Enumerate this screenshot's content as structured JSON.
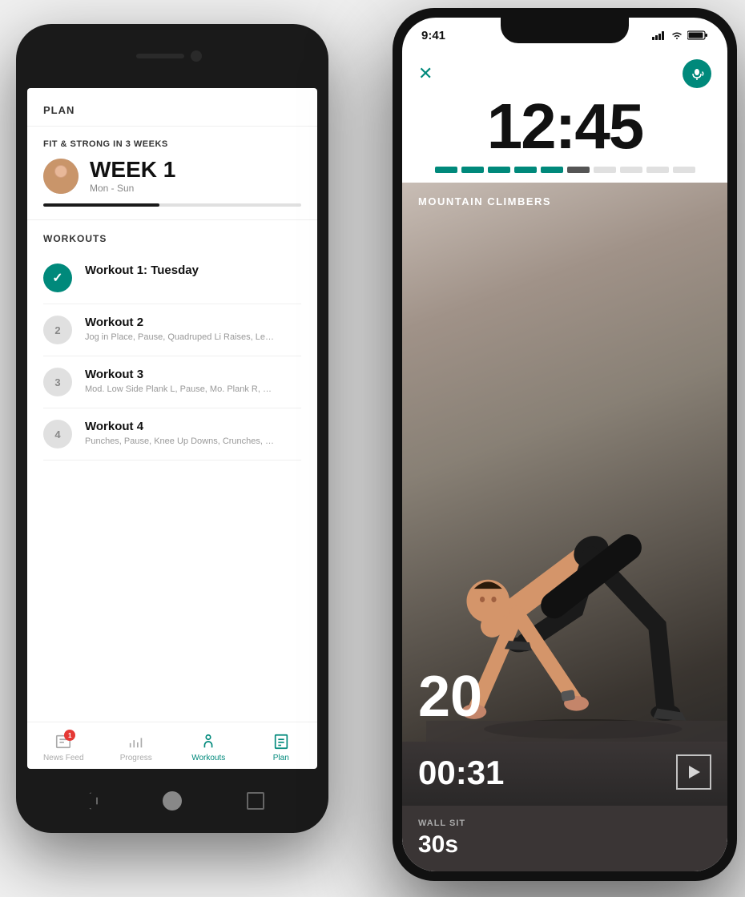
{
  "left_phone": {
    "plan_header": "PLAN",
    "plan_name": "FIT & STRONG IN 3 WEEKS",
    "week_label": "WEEK 1",
    "week_days": "Mon - Sun",
    "progress_percent": 45,
    "workouts_header": "WORKOUTS",
    "workouts": [
      {
        "id": 1,
        "name": "Workout 1: Tuesday",
        "desc": "",
        "completed": true
      },
      {
        "id": 2,
        "name": "Workout 2",
        "desc": "Jog in Place, Pause, Quadruped Li\nRaises, Leg Raises, Russian Twist",
        "completed": false
      },
      {
        "id": 3,
        "name": "Workout 3",
        "desc": "Mod. Low Side Plank L, Pause, Mo.\nPlank R, Plié Squats, Triceps Dip, C",
        "completed": false
      },
      {
        "id": 4,
        "name": "Workout 4",
        "desc": "Punches, Pause, Knee Up Downs, \nCrunches, Quadruped Limb Raises",
        "completed": false
      }
    ],
    "tab_bar": [
      {
        "label": "News Feed",
        "icon": "news-feed-icon",
        "badge": 1,
        "active": false
      },
      {
        "label": "Progress",
        "icon": "progress-icon",
        "badge": null,
        "active": false
      },
      {
        "label": "Workouts",
        "icon": "workouts-icon",
        "badge": null,
        "active": true
      },
      {
        "label": "Plan",
        "icon": "plan-icon",
        "badge": null,
        "active": false
      }
    ]
  },
  "right_phone": {
    "status_time": "9:41",
    "timer": "12:45",
    "exercise_name": "MOUNTAIN CLIMBERS",
    "exercise_reps": "20",
    "exercise_timer": "00:31",
    "next_exercise_label": "WALL SIT",
    "next_exercise_duration": "30s",
    "progress_dots": [
      "filled",
      "filled",
      "filled",
      "filled",
      "filled",
      "half",
      "empty",
      "empty",
      "empty",
      "empty"
    ]
  }
}
